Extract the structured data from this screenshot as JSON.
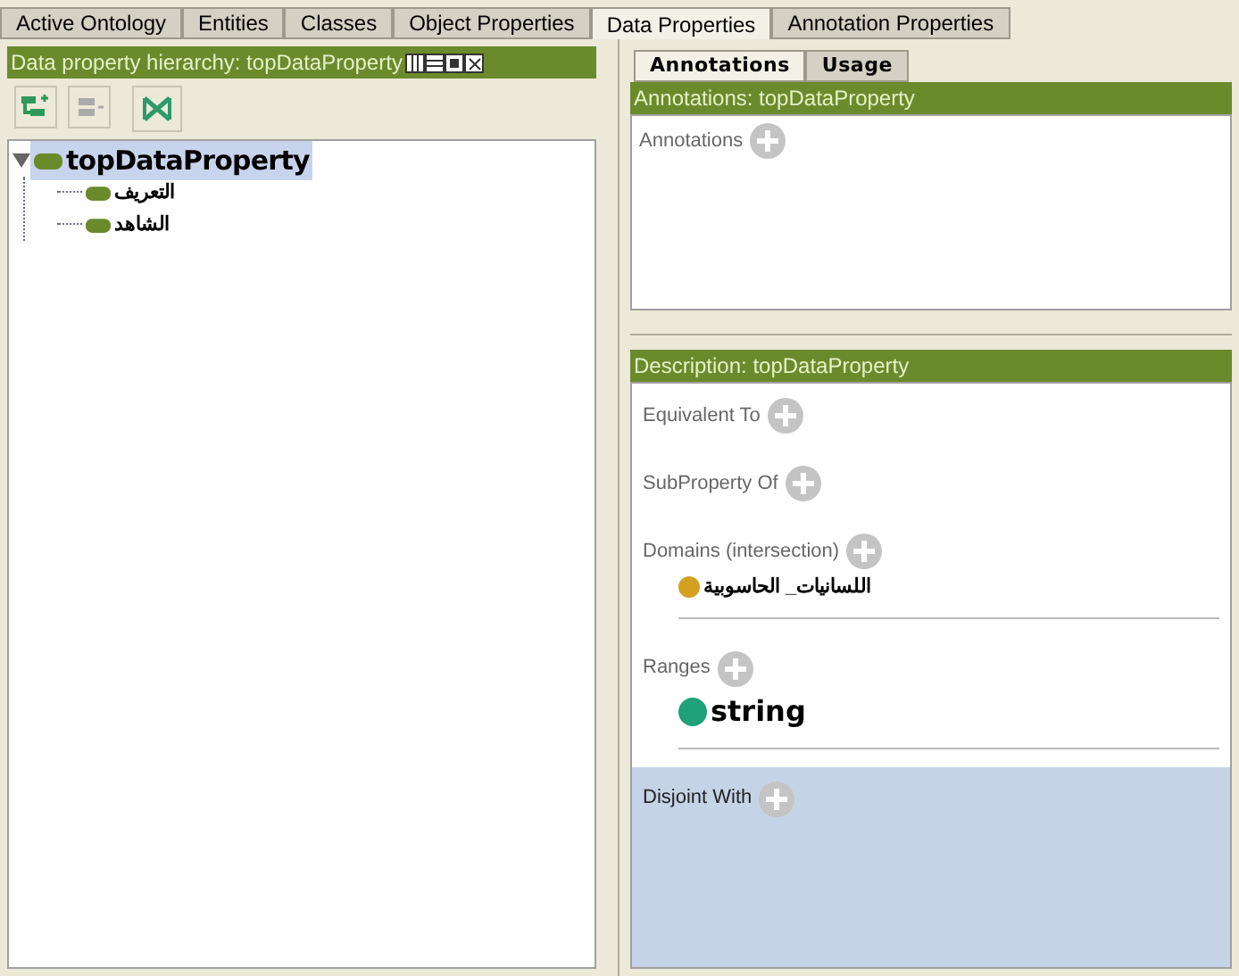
{
  "tabs": [
    {
      "label": "Active Ontology",
      "selected": false
    },
    {
      "label": "Entities",
      "selected": false
    },
    {
      "label": "Classes",
      "selected": false
    },
    {
      "label": "Object Properties",
      "selected": false
    },
    {
      "label": "Data Properties",
      "selected": true
    },
    {
      "label": "Annotation Properties",
      "selected": false
    }
  ],
  "hierarchy": {
    "title": "Data property hierarchy: topDataProperty",
    "tree": [
      {
        "label": "topDataProperty",
        "expanded": true,
        "selected": true,
        "children": [
          {
            "label": "التعريف",
            "selected": false
          },
          {
            "label": "الشاهد",
            "selected": false
          }
        ]
      }
    ]
  },
  "subtabs": [
    {
      "label": "Annotations",
      "selected": true
    },
    {
      "label": "Usage",
      "selected": false
    }
  ],
  "annotations": {
    "title": "Annotations: topDataProperty",
    "label": "Annotations"
  },
  "description": {
    "title": "Description: topDataProperty",
    "sections": [
      {
        "label": "Equivalent To",
        "selected": false
      },
      {
        "label": "SubProperty Of",
        "selected": false
      },
      {
        "label": "Domains (intersection)",
        "selected": false,
        "items": [
          {
            "label": "اللسانيات_ الحاسوبية",
            "kind": "class",
            "color": "#d4a020"
          }
        ]
      },
      {
        "label": "Ranges",
        "selected": false,
        "items": [
          {
            "label": "string",
            "kind": "datatype",
            "color": "#1fa27a"
          }
        ]
      },
      {
        "label": "Disjoint With",
        "selected": true
      }
    ]
  }
}
